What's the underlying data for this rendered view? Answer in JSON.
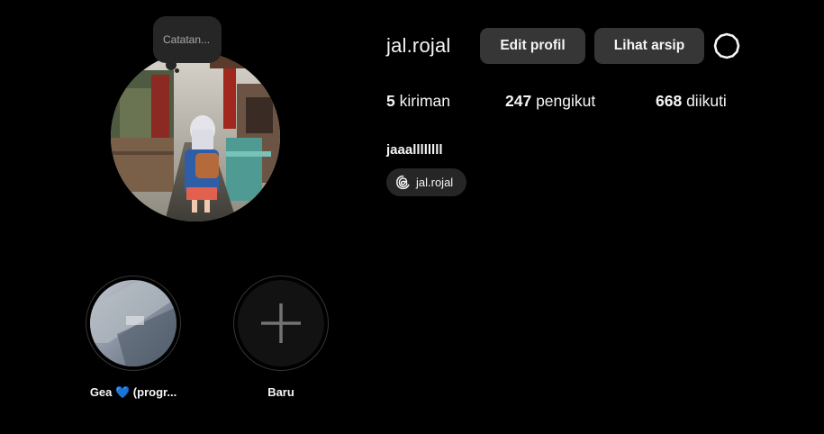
{
  "note": {
    "text": "Catatan..."
  },
  "profile": {
    "username": "jal.rojal",
    "display_name": "jaaallllllll",
    "avatar_icon": "profile-photo"
  },
  "actions": {
    "edit_profile_label": "Edit profil",
    "view_archive_label": "Lihat arsip",
    "settings_icon": "gear-icon"
  },
  "stats": {
    "posts": {
      "count": "5",
      "label": "kiriman"
    },
    "followers": {
      "count": "247",
      "label": "pengikut"
    },
    "following": {
      "count": "668",
      "label": "diikuti"
    }
  },
  "threads": {
    "icon": "threads-icon",
    "handle": "jal.rojal"
  },
  "highlights": [
    {
      "label": "Gea 💙 (progr...",
      "icon": "highlight-cover"
    },
    {
      "label": "Baru",
      "icon": "plus-icon"
    }
  ],
  "colors": {
    "background": "#000000",
    "button_bg": "#363636",
    "badge_bg": "#262626",
    "text_primary": "#f5f5f5",
    "text_secondary": "#a8a8a8"
  }
}
